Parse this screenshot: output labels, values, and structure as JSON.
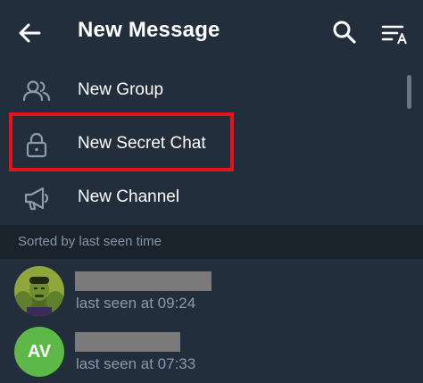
{
  "header": {
    "title": "New Message",
    "back_icon": "arrow-left-icon",
    "search_icon": "search-icon",
    "sort_icon": "sort-alphabet-icon"
  },
  "menu": {
    "items": [
      {
        "label": "New Group",
        "icon": "people-icon"
      },
      {
        "label": "New Secret Chat",
        "icon": "lock-icon"
      },
      {
        "label": "New Channel",
        "icon": "megaphone-icon"
      }
    ],
    "highlighted_item": "New Secret Chat"
  },
  "section": {
    "title": "Sorted by last seen time"
  },
  "contacts": [
    {
      "avatar": "hulk-photo",
      "status": "last seen at 09:24"
    },
    {
      "avatar_initials": "AV",
      "status": "last seen at 07:33"
    }
  ],
  "colors": {
    "header_bg": "#232e3c",
    "page_bg": "#1d2733",
    "section_bg": "#1a222c",
    "highlight": "#e3141b",
    "avatar_green": "#5eb848",
    "secondary_text": "#8a99a8"
  }
}
